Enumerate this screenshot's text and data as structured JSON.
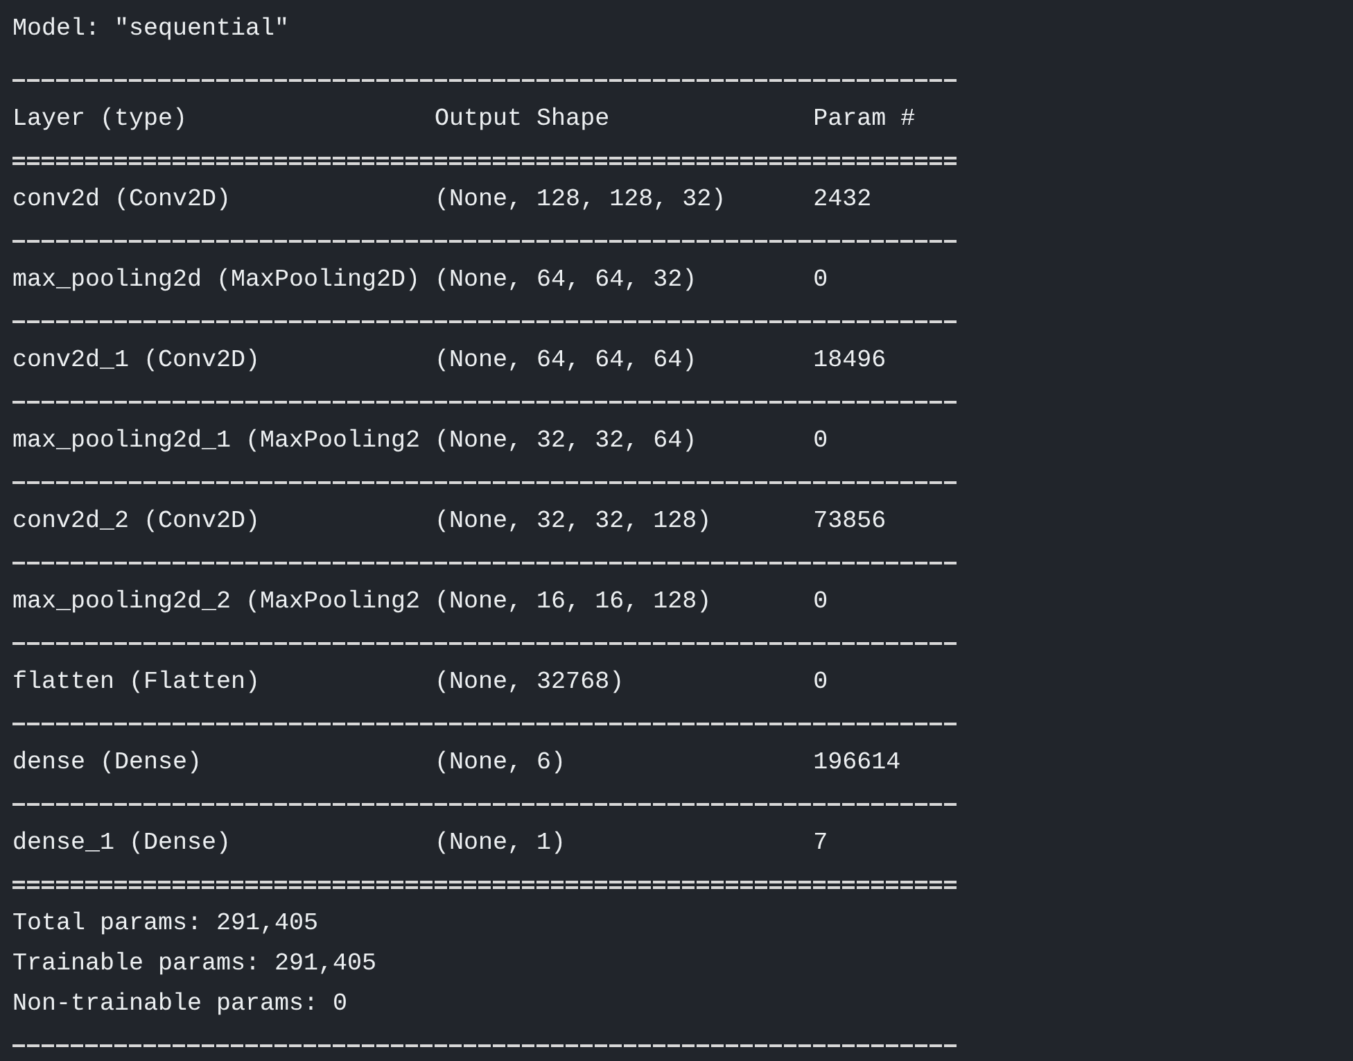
{
  "model_line": "Model: \"sequential\"",
  "columns": [
    "Layer (type)",
    "Output Shape",
    "Param #"
  ],
  "rows": [
    {
      "layer": "conv2d (Conv2D)",
      "shape": "(None, 128, 128, 32)",
      "params": "2432"
    },
    {
      "layer": "max_pooling2d (MaxPooling2D)",
      "shape": "(None, 64, 64, 32)",
      "params": "0"
    },
    {
      "layer": "conv2d_1 (Conv2D)",
      "shape": "(None, 64, 64, 64)",
      "params": "18496"
    },
    {
      "layer": "max_pooling2d_1 (MaxPooling2",
      "shape": "(None, 32, 32, 64)",
      "params": "0"
    },
    {
      "layer": "conv2d_2 (Conv2D)",
      "shape": "(None, 32, 32, 128)",
      "params": "73856"
    },
    {
      "layer": "max_pooling2d_2 (MaxPooling2",
      "shape": "(None, 16, 16, 128)",
      "params": "0"
    },
    {
      "layer": "flatten (Flatten)",
      "shape": "(None, 32768)",
      "params": "0"
    },
    {
      "layer": "dense (Dense)",
      "shape": "(None, 6)",
      "params": "196614"
    },
    {
      "layer": "dense_1 (Dense)",
      "shape": "(None, 1)",
      "params": "7"
    }
  ],
  "totals": [
    "Total params: 291,405",
    "Trainable params: 291,405",
    "Non-trainable params: 0"
  ]
}
